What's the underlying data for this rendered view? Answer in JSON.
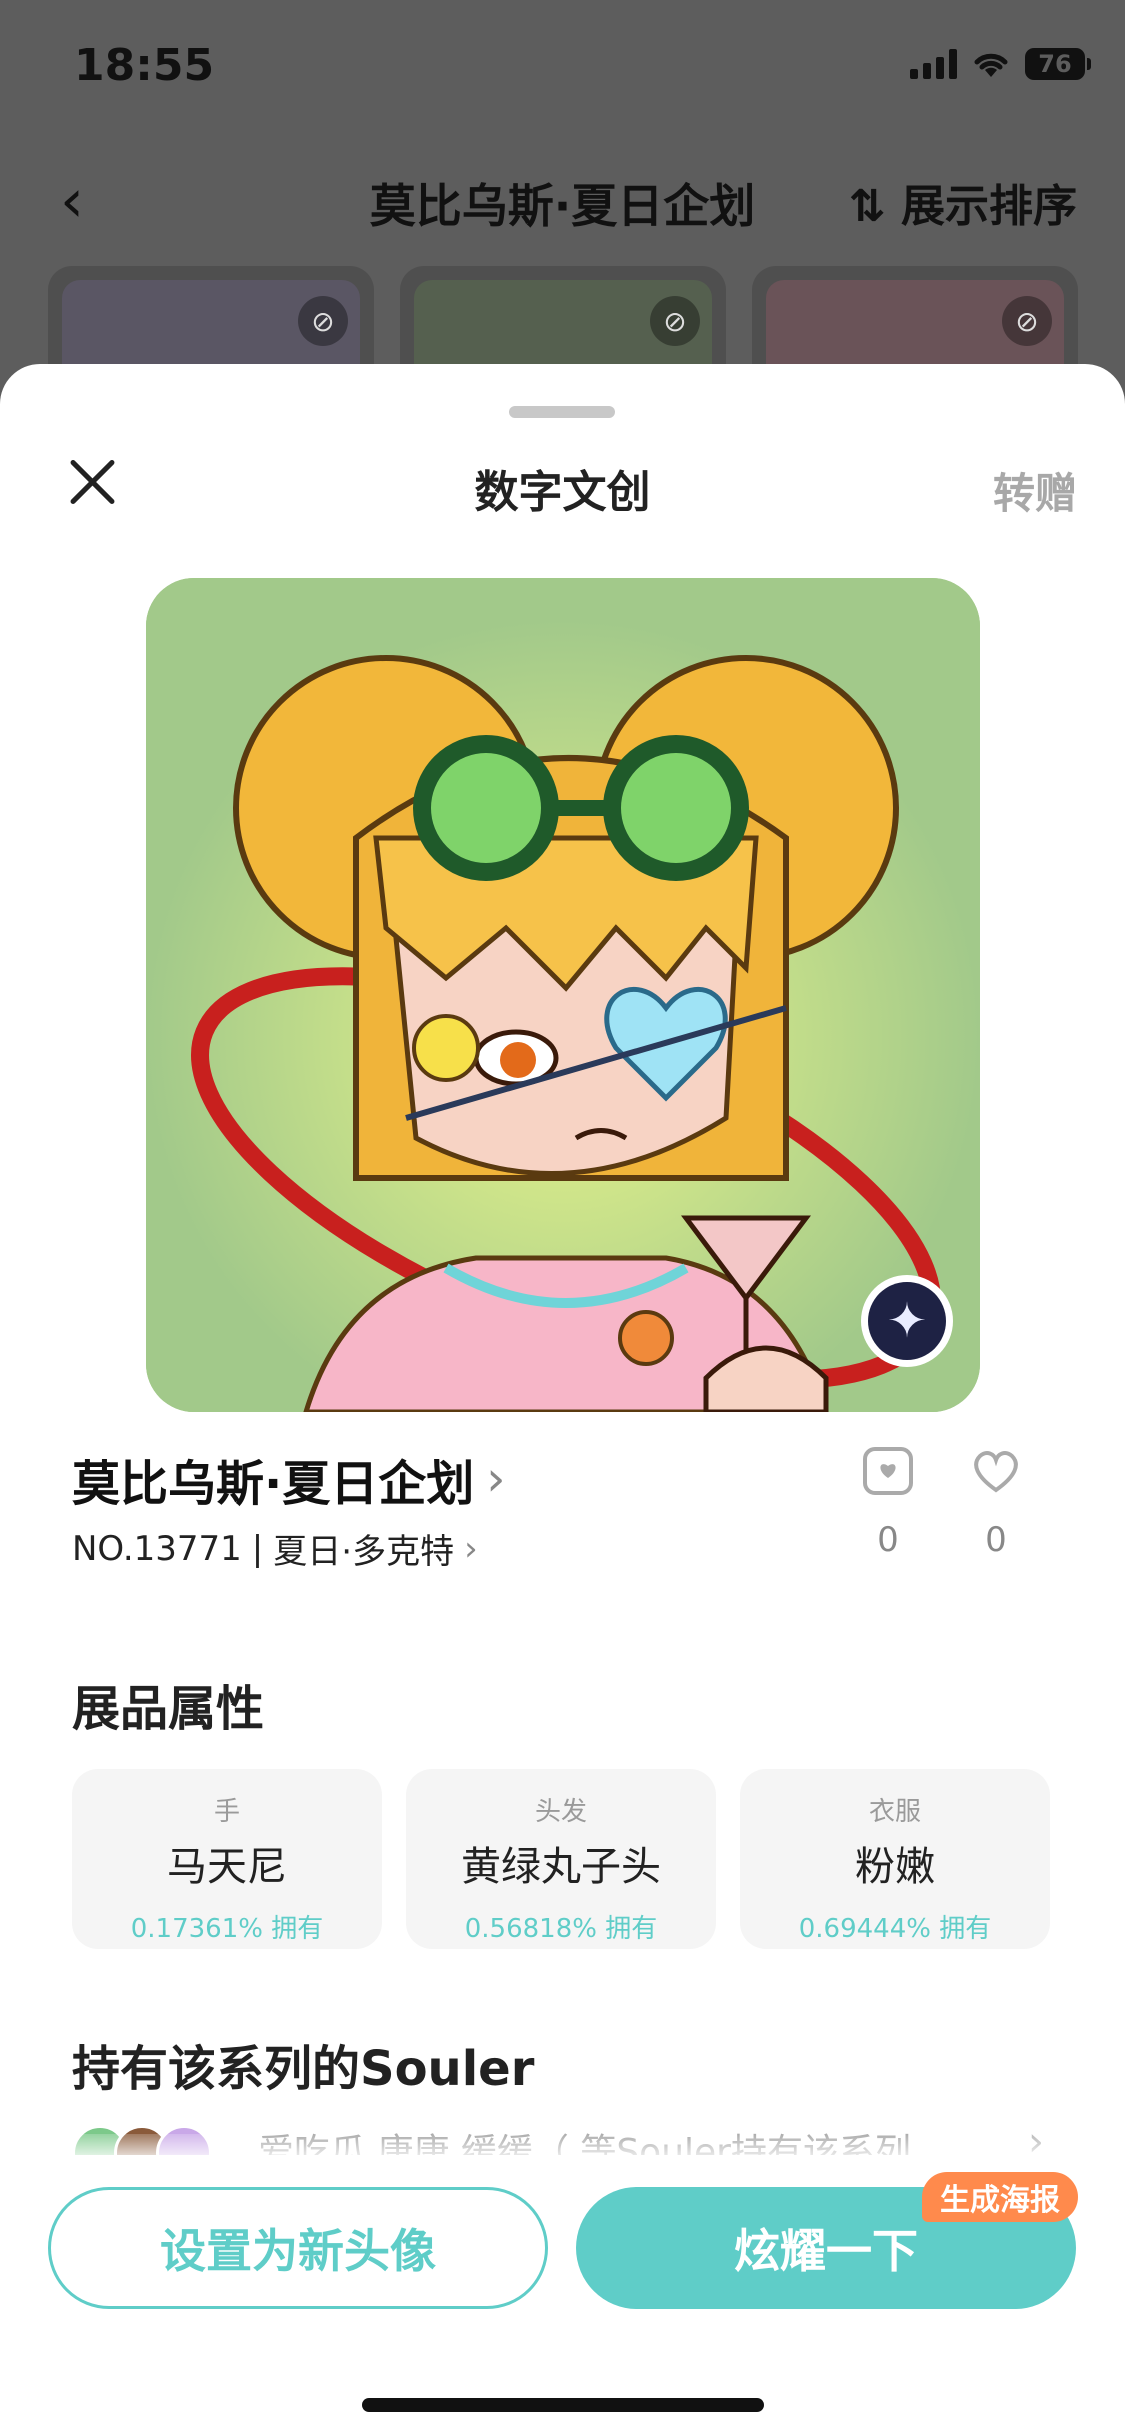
{
  "status": {
    "time": "18:55",
    "battery": "76"
  },
  "bg_header": {
    "back": "‹",
    "title": "莫比乌斯·夏日企划",
    "sort_label": "展示排序"
  },
  "sheet": {
    "title": "数字文创",
    "transfer_label": "转赠"
  },
  "item": {
    "name": "莫比乌斯·夏日企划",
    "number": "NO.13771",
    "edition": "夏日·多克特",
    "collect_count": "0",
    "like_count": "0"
  },
  "attributes": {
    "heading": "展品属性",
    "items": [
      {
        "category": "手",
        "value": "马天尼",
        "rarity": "0.17361% 拥有"
      },
      {
        "category": "头发",
        "value": "黄绿丸子头",
        "rarity": "0.56818% 拥有"
      },
      {
        "category": "衣服",
        "value": "粉嫩",
        "rarity": "0.69444% 拥有"
      }
    ]
  },
  "holders": {
    "heading": "持有该系列的Souler",
    "text": "爱吃瓜   康康   缓缓（   等Souler持有该系列"
  },
  "buttons": {
    "set_avatar": "设置为新头像",
    "show_off": "炫耀一下",
    "poster_tag": "生成海报"
  },
  "colors": {
    "accent": "#5fcdc8",
    "poster_tag": "#ff8a4c",
    "art_background": "#a2c98a"
  },
  "icons": [
    "back-icon",
    "sort-icon",
    "eye-off-icon",
    "close-icon",
    "star-badge-icon",
    "collect-icon",
    "heart-icon",
    "chevron-right-icon"
  ]
}
